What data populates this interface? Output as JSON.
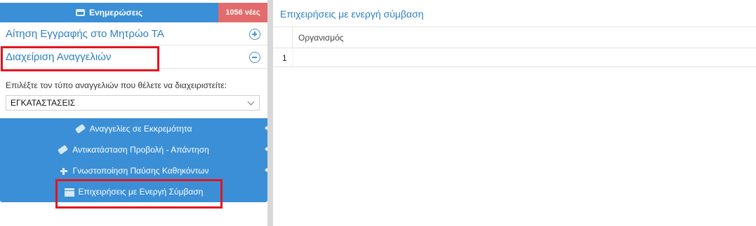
{
  "notifications": {
    "label": "Ενημερώσεις",
    "count": "1056 νέες",
    "icon": "inbox-icon"
  },
  "accordion": [
    {
      "label": "Αίτηση Εγγραφής στο Μητρώο ΤΑ",
      "icon": "plus-circle-icon",
      "expanded": false
    },
    {
      "label": "Διαχείριση Αναγγελιών",
      "icon": "minus-circle-icon",
      "expanded": true
    }
  ],
  "select": {
    "label": "Επιλέξτε τον τύπο αναγγελιών που θέλετε να διαχειριστείτε:",
    "value": "ΕΓΚΑΤΑΣΤΑΣΕΙΣ"
  },
  "menu": [
    {
      "label": "Αναγγελίες σε Εκκρεμότητα",
      "icon": "tag-icon"
    },
    {
      "label": "Αντικατάσταση Προβολή - Απάντηση",
      "icon": "tag-icon"
    },
    {
      "label": "Γνωστοποίηση Παύσης Καθηκόντων",
      "icon": "plus-icon"
    },
    {
      "label": "Επιχειρήσεις με Ενεργή Σύμβαση",
      "icon": "archive-box-icon"
    }
  ],
  "main": {
    "title": "Επιχειρήσεις με ενεργή σύμβαση",
    "columns": [
      "Οργανισμός"
    ],
    "rows": [
      {
        "num": "1",
        "organization": ""
      }
    ]
  },
  "colors": {
    "accent": "#3a8fd6",
    "badge": "#e46b6b",
    "link": "#2e7fc6",
    "annotation": "#e3141e"
  }
}
